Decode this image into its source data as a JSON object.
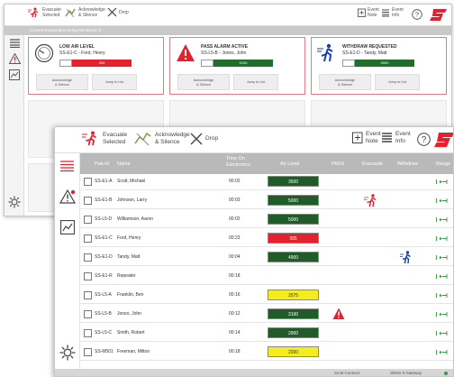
{
  "back_window": {
    "toolbar": {
      "evacuate_label": "Evacuate\nSelected",
      "acknowledge_label": "Acknowledge\n& Silence",
      "drop_label": "Drop",
      "event_note_label": "Event\nNote",
      "event_info_label": "Event\nInfo"
    },
    "monitor_bar": "Current Responders being Monitored: 8",
    "cards": [
      {
        "title": "LOW AIR LEVEL",
        "subtitle": "SS-E1-C - Ford, Henry",
        "gauge_value": "305",
        "gauge_color": "#e5212e",
        "ack_label": "Acknowledge\n& Silence",
        "jump_label": "Jump to List"
      },
      {
        "title": "PASS ALARM ACTIVE",
        "subtitle": "SS-L5-B - Jones, John",
        "gauge_value": "3100",
        "gauge_color": "#1f6e2c",
        "ack_label": "Acknowledge\n& Silence",
        "jump_label": "Jump to List"
      },
      {
        "title": "WITHDRAW REQUESTED",
        "subtitle": "SS-E1-D - Tandy, Matt",
        "gauge_value": "4900",
        "gauge_color": "#1f6e2c",
        "ack_label": "Acknowledge\n& Silence",
        "jump_label": "Jump to List"
      }
    ]
  },
  "front_window": {
    "toolbar": {
      "evacuate_label": "Evacuate\nSelected",
      "acknowledge_label": "Acknowledge\n& Silence",
      "drop_label": "Drop",
      "event_note_label": "Event\nNote",
      "event_info_label": "Event\nInfo"
    },
    "columns": {
      "pak_id": "Pak-Id",
      "name": "Name",
      "time_on": "Time On\nElectronics",
      "air_level": "Air Level",
      "pass": "PASS",
      "evacuate": "Evacuate",
      "withdraw": "Withdraw",
      "range": "Range"
    },
    "rows": [
      {
        "pak_id": "SS-E1-A",
        "name": "Scott, Michael",
        "time": "00:02",
        "air": "3500",
        "air_color": "#1f5c27",
        "air_text": "#ffffff",
        "pass": false,
        "evacuate": false,
        "withdraw": false
      },
      {
        "pak_id": "SS-E1-B",
        "name": "Johnson, Larry",
        "time": "00:03",
        "air": "5000",
        "air_color": "#1f5c27",
        "air_text": "#ffffff",
        "pass": false,
        "evacuate": true,
        "withdraw": false
      },
      {
        "pak_id": "SS-L5-D",
        "name": "Williamson, Aaron",
        "time": "00:02",
        "air": "5000",
        "air_color": "#1f5c27",
        "air_text": "#ffffff",
        "pass": false,
        "evacuate": false,
        "withdraw": false
      },
      {
        "pak_id": "SS-E1-C",
        "name": "Ford, Henry",
        "time": "00:23",
        "air": "305",
        "air_color": "#e5212e",
        "air_text": "#ffffff",
        "pass": false,
        "evacuate": false,
        "withdraw": false
      },
      {
        "pak_id": "SS-E1-D",
        "name": "Tandy, Matt",
        "time": "00:04",
        "air": "4900",
        "air_color": "#1f5c27",
        "air_text": "#ffffff",
        "pass": false,
        "evacuate": false,
        "withdraw": true
      },
      {
        "pak_id": "SS-E1-R",
        "name": "Repeater",
        "time": "00:18",
        "air": "",
        "air_color": "",
        "air_text": "",
        "pass": false,
        "evacuate": false,
        "withdraw": false
      },
      {
        "pak_id": "SS-L5-A",
        "name": "Franklin, Ben",
        "time": "00:16",
        "air": "2575",
        "air_color": "#f5ec1c",
        "air_text": "#333333",
        "pass": false,
        "evacuate": false,
        "withdraw": false
      },
      {
        "pak_id": "SS-L5-B",
        "name": "Jones, John",
        "time": "00:12",
        "air": "3100",
        "air_color": "#1f5c27",
        "air_text": "#ffffff",
        "pass": true,
        "evacuate": false,
        "withdraw": false
      },
      {
        "pak_id": "SS-L5-C",
        "name": "Smith, Robert",
        "time": "00:14",
        "air": "2900",
        "air_color": "#1f5c27",
        "air_text": "#ffffff",
        "pass": false,
        "evacuate": false,
        "withdraw": false
      },
      {
        "pak_id": "SS-M501",
        "name": "Freeman, Milton",
        "time": "00:18",
        "air": "2200",
        "air_color": "#f5ec1c",
        "air_text": "#333333",
        "pass": false,
        "evacuate": false,
        "withdraw": false
      }
    ],
    "status_bar": {
      "connection": "Scott Connect",
      "gateway": "SENS 8 Gateway"
    }
  },
  "colors": {
    "brand_red": "#e5212e",
    "evacuate_red": "#e5212e",
    "withdraw_blue": "#1a3fa8",
    "range_green": "#2e9e3a",
    "header_gray": "#b9b9b9"
  },
  "icons": {
    "evacuate": "evacuate-runner-icon",
    "acknowledge": "acknowledge-silence-icon",
    "drop": "drop-x-icon",
    "event_note": "event-note-icon",
    "event_info": "event-info-icon",
    "help": "help-icon",
    "brand": "scott-logo-icon",
    "menu": "list-menu-icon",
    "alert": "alert-icon",
    "report": "report-icon",
    "settings": "gear-icon"
  }
}
